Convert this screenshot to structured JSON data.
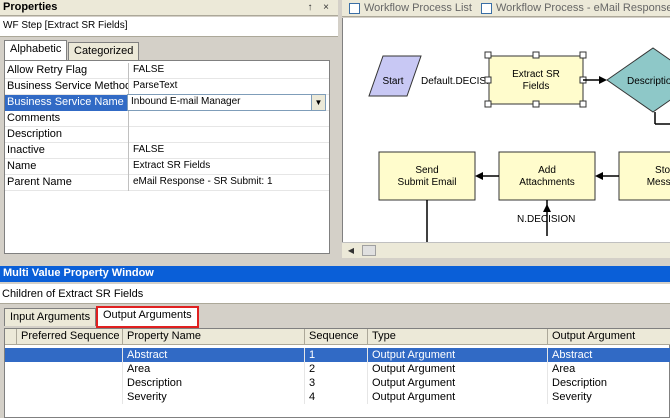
{
  "properties": {
    "title": "Properties",
    "pin_glyph": "↑",
    "close_glyph": "×",
    "subtitle": "WF Step [Extract SR Fields]",
    "tabs": [
      {
        "label": "Alphabetic",
        "active": true
      },
      {
        "label": "Categorized",
        "active": false
      }
    ],
    "rows": [
      {
        "key": "Allow Retry Flag",
        "value": "FALSE"
      },
      {
        "key": "Business Service Method",
        "value": "ParseText"
      },
      {
        "key": "Business Service Name",
        "value": "Inbound E-mail Manager"
      },
      {
        "key": "Comments",
        "value": ""
      },
      {
        "key": "Description",
        "value": ""
      },
      {
        "key": "Inactive",
        "value": "FALSE"
      },
      {
        "key": "Name",
        "value": "Extract SR Fields"
      },
      {
        "key": "Parent Name",
        "value": "eMail Response - SR Submit: 1"
      }
    ],
    "dropdown_value": "Inbound E-mail Manager"
  },
  "workflow": {
    "tabs": [
      {
        "label": "Workflow Process List"
      },
      {
        "label": "Workflow Process - eMail Response"
      }
    ],
    "nodes": {
      "start": "Start",
      "extract": [
        "Extract SR",
        "Fields"
      ],
      "decision": "Description",
      "send": [
        "Send",
        "Submit Email"
      ],
      "add": [
        "Add",
        "Attachments"
      ],
      "store": [
        "Store",
        "Message"
      ]
    },
    "edges": {
      "default_decision": "Default.DECISION",
      "n_decision": "N.DECISION"
    }
  },
  "multi_value": {
    "title": "Multi Value Property Window",
    "subtitle": "Children of Extract SR Fields",
    "tabs": [
      {
        "label": "Input Arguments",
        "active": false
      },
      {
        "label": "Output Arguments",
        "active": true
      }
    ],
    "columns": [
      "Preferred Sequence",
      "Property Name",
      "Sequence",
      "Type",
      "Output Argument"
    ],
    "rows": [
      {
        "pref": "",
        "name": "Abstract",
        "seq": "1",
        "type": "Output Argument",
        "out": "Abstract",
        "selected": true
      },
      {
        "pref": "",
        "name": "Area",
        "seq": "2",
        "type": "Output Argument",
        "out": "Area",
        "selected": false
      },
      {
        "pref": "",
        "name": "Description",
        "seq": "3",
        "type": "Output Argument",
        "out": "Description",
        "selected": false
      },
      {
        "pref": "",
        "name": "Severity",
        "seq": "4",
        "type": "Output Argument",
        "out": "Severity",
        "selected": false
      }
    ]
  },
  "colors": {
    "accent": "#0a5fd8",
    "selection": "#316ac5",
    "highlight_box": "#e02020",
    "node_fill": "#fffccc",
    "start_fill": "#c8c8f4",
    "decision_fill": "#8ec8c8"
  }
}
